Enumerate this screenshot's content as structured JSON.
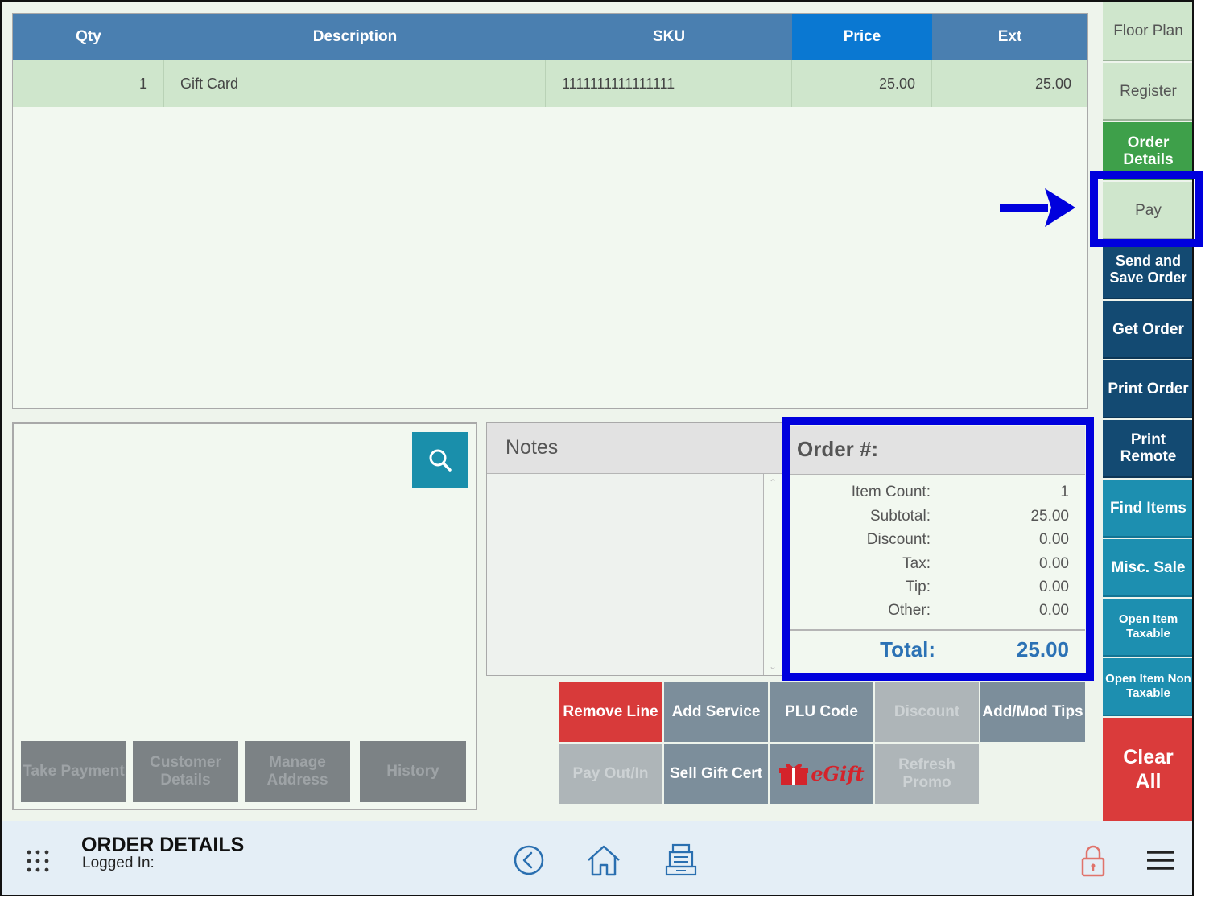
{
  "table": {
    "headers": [
      "Qty",
      "Description",
      "SKU",
      "Price",
      "Ext"
    ],
    "rows": [
      {
        "qty": "1",
        "description": "Gift Card",
        "sku": "1111111111111111",
        "price": "25.00",
        "ext": "25.00"
      }
    ]
  },
  "customer_buttons": {
    "take_payment": "Take Payment",
    "customer_details": "Customer Details",
    "manage_address": "Manage Address",
    "history": "History"
  },
  "notes": {
    "title": "Notes",
    "value": ""
  },
  "summary": {
    "title": "Order #:",
    "item_count_label": "Item Count:",
    "item_count": "1",
    "subtotal_label": "Subtotal:",
    "subtotal": "25.00",
    "discount_label": "Discount:",
    "discount": "0.00",
    "tax_label": "Tax:",
    "tax": "0.00",
    "tip_label": "Tip:",
    "tip": "0.00",
    "other_label": "Other:",
    "other": "0.00",
    "total_label": "Total:",
    "total": "25.00"
  },
  "actions": {
    "remove_line": "Remove Line",
    "add_service": "Add Service",
    "plu_code": "PLU Code",
    "discount": "Discount",
    "add_mod_tips": "Add/Mod Tips",
    "pay_out_in": "Pay Out/In",
    "sell_gift_cert": "Sell Gift Cert",
    "egift": "eGift",
    "refresh_promo": "Refresh Promo"
  },
  "sidebar": {
    "floor_plan": "Floor Plan",
    "register": "Register",
    "order_details": "Order Details",
    "pay": "Pay",
    "send_and_save_order": "Send and Save Order",
    "get_order": "Get Order",
    "print_order": "Print Order",
    "print_remote": "Print Remote",
    "find_items": "Find Items",
    "misc_sale": "Misc. Sale",
    "open_item_taxable": "Open Item Taxable",
    "open_item_non_taxable": "Open Item Non Taxable",
    "clear_all": "Clear All"
  },
  "footer": {
    "page_title": "ORDER DETAILS",
    "logged_in": "Logged In:"
  },
  "colors": {
    "header_blue": "#4a7fb0",
    "active_header": "#0a78d2",
    "highlight_blue": "#0000dd",
    "clear_red": "#da3b3b",
    "green": "#3ea04a"
  }
}
